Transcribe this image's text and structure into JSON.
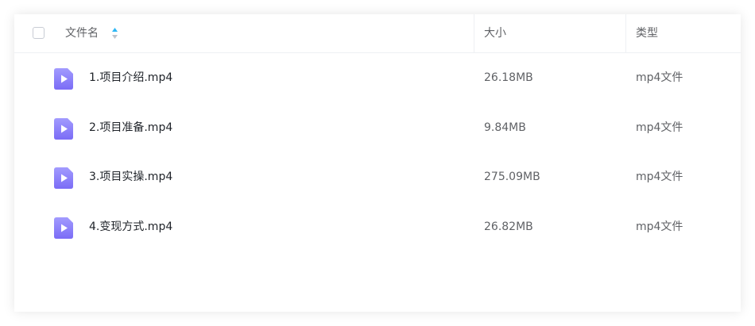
{
  "table": {
    "headers": {
      "name": "文件名",
      "size": "大小",
      "type": "类型"
    },
    "rows": [
      {
        "name": "1.项目介绍.mp4",
        "size": "26.18MB",
        "type": "mp4文件",
        "icon": "video-file-icon"
      },
      {
        "name": "2.项目准备.mp4",
        "size": "9.84MB",
        "type": "mp4文件",
        "icon": "video-file-icon"
      },
      {
        "name": "3.项目实操.mp4",
        "size": "275.09MB",
        "type": "mp4文件",
        "icon": "video-file-icon"
      },
      {
        "name": "4.变现方式.mp4",
        "size": "26.82MB",
        "type": "mp4文件",
        "icon": "video-file-icon"
      }
    ]
  },
  "colors": {
    "accent": "#2db7f5",
    "icon_gradient_top": "#a29bfe",
    "icon_gradient_bottom": "#7b6cf6"
  }
}
